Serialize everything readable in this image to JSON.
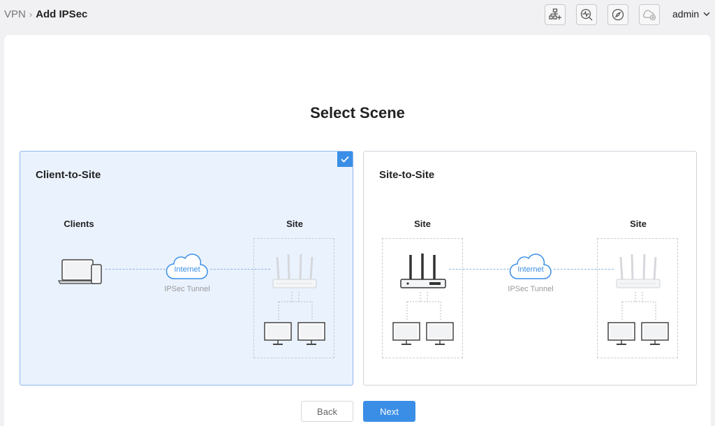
{
  "breadcrumb": {
    "parent": "VPN",
    "separator": "›",
    "current": "Add IPSec"
  },
  "toolbar": {
    "icons": [
      "topology-icon",
      "diagnose-icon",
      "compass-icon",
      "cloud-offline-icon"
    ],
    "user": "admin"
  },
  "page": {
    "title": "Select Scene"
  },
  "scenes": [
    {
      "title": "Client-to-Site",
      "selected": true,
      "left_label": "Clients",
      "right_label": "Site",
      "cloud_label": "Internet",
      "tunnel_label": "IPSec Tunnel"
    },
    {
      "title": "Site-to-Site",
      "selected": false,
      "left_label": "Site",
      "right_label": "Site",
      "cloud_label": "Internet",
      "tunnel_label": "IPSec Tunnel"
    }
  ],
  "buttons": {
    "back": "Back",
    "next": "Next"
  },
  "colors": {
    "accent": "#3a8ee6",
    "selected_bg": "#eaf2fd"
  }
}
